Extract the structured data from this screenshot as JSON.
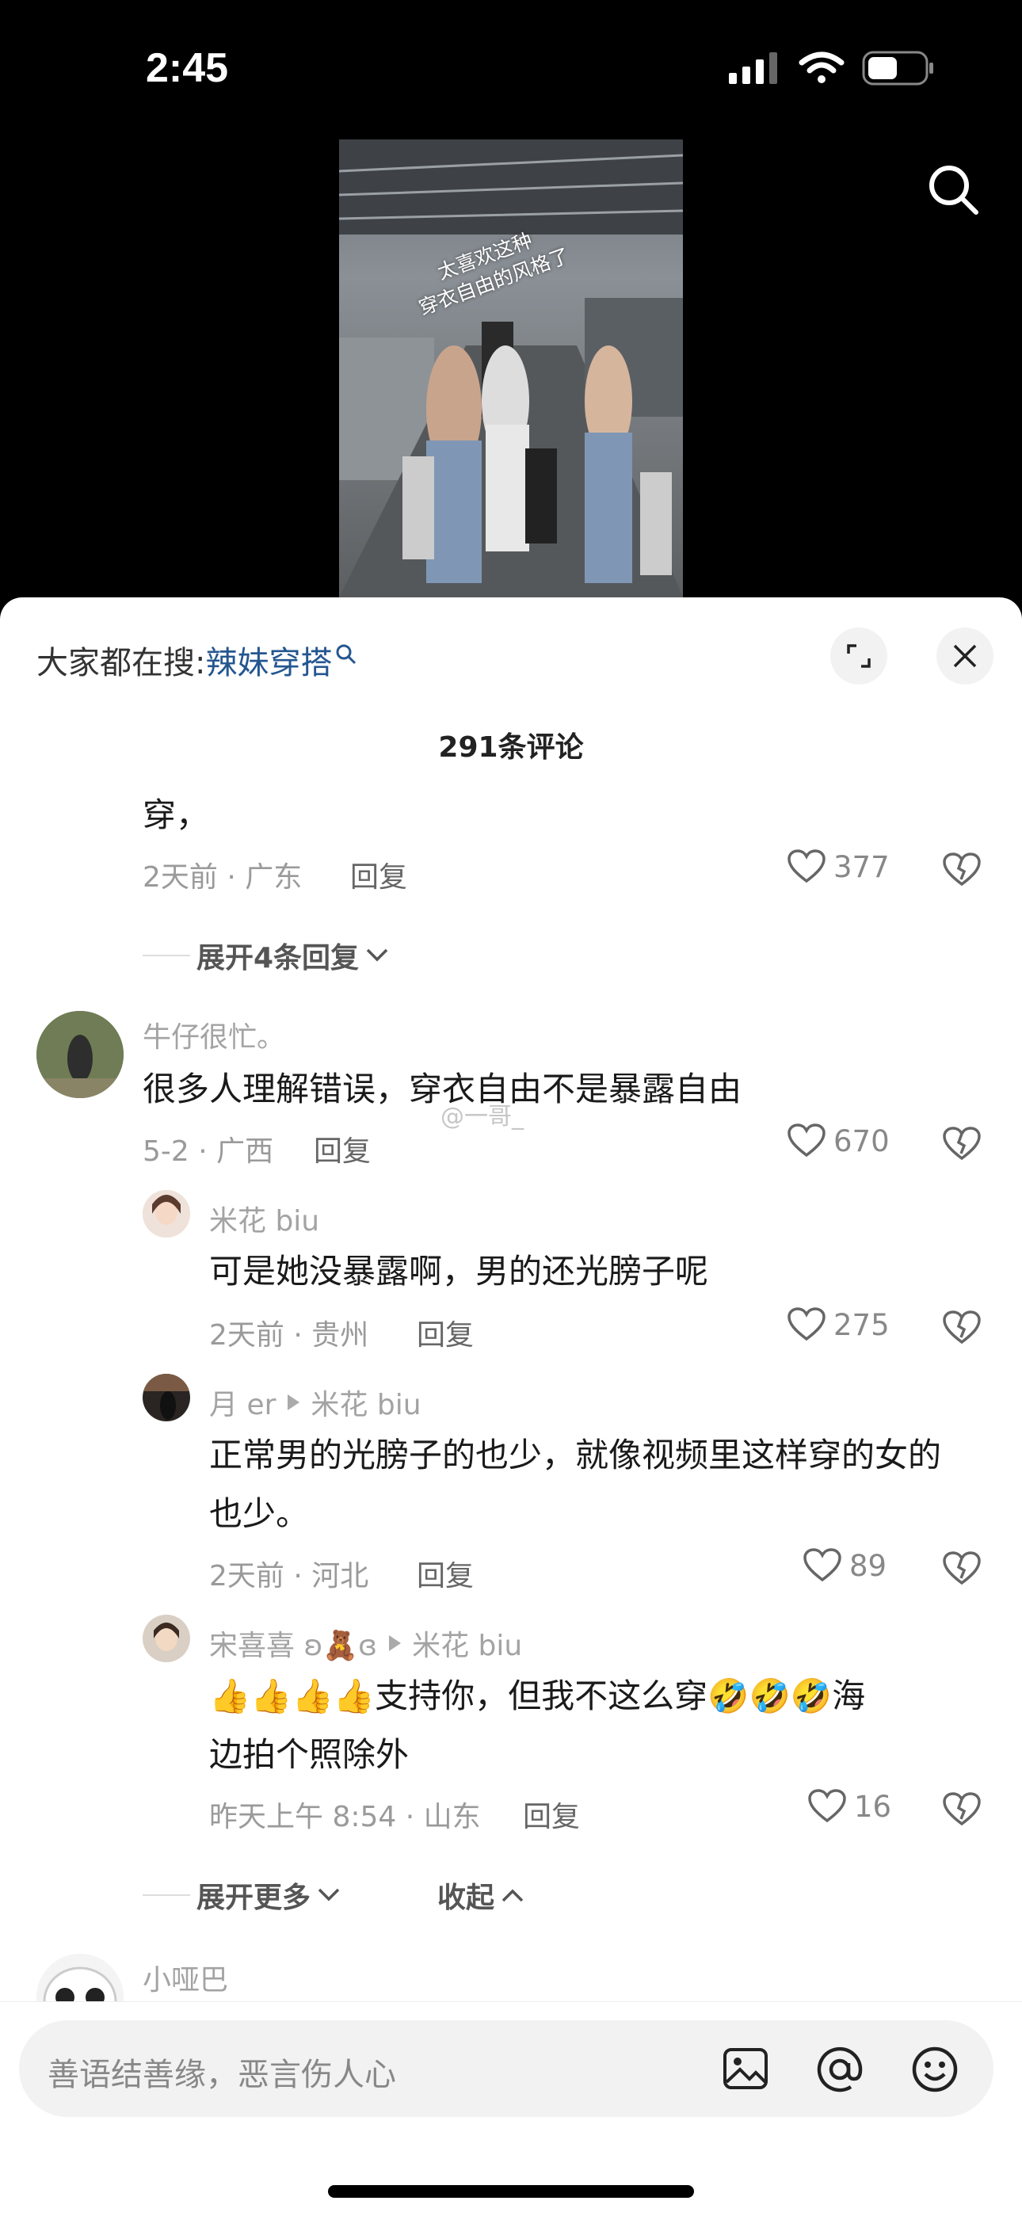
{
  "status": {
    "time": "2:45"
  },
  "video": {
    "caption_line1": "太喜欢这种",
    "caption_line2": "穿衣自由的风格了"
  },
  "hot_search": {
    "prefix": "大家都在搜: ",
    "term": "辣妹穿搭"
  },
  "comments_header": {
    "count_label": "291条评论"
  },
  "comments": [
    {
      "text": "穿，",
      "meta": "2天前 · 广东",
      "reply": "回复",
      "likes": "377"
    },
    {
      "expand_label": "展开4条回复"
    },
    {
      "user": "牛仔很忙。",
      "text": "很多人理解错误，穿衣自由不是暴露自由",
      "meta": "5-2 · 广西",
      "reply": "回复",
      "likes": "670"
    },
    {
      "user": "米花 biu",
      "text": "可是她没暴露啊，男的还光膀子呢",
      "meta": "2天前 · 贵州",
      "reply": "回复",
      "likes": "275"
    },
    {
      "user": "月 er",
      "reply_to": "米花 biu",
      "text_line1": "正常男的光膀子的也少，就像视频里这样穿的女的",
      "text_line2": "也少。",
      "meta": "2天前 · 河北",
      "reply": "回复",
      "likes": "89"
    },
    {
      "user": "宋喜喜 ʚ🧸ɞ",
      "reply_to": "米花 biu",
      "text_line1": "👍👍👍👍支持你，但我不这么穿🤣🤣🤣海",
      "text_line2": "边拍个照除外",
      "meta": "昨天上午 8:54 · 山东",
      "reply": "回复",
      "likes": "16"
    },
    {
      "expand_more": "展开更多",
      "collapse": "收起"
    },
    {
      "user": "小哑巴"
    }
  ],
  "watermark": "@一哥_",
  "input": {
    "placeholder": "善语结善缘，恶言伤人心"
  },
  "icons": [
    "search-icon",
    "expand-icon",
    "close-icon",
    "heart-icon",
    "broken-heart-icon",
    "image-icon",
    "at-icon",
    "emoji-icon"
  ]
}
